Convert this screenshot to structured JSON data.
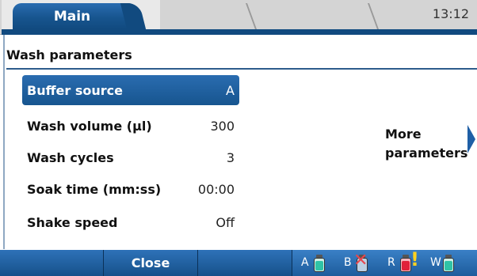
{
  "header": {
    "tab_main": "Main",
    "clock": "13:12"
  },
  "section": {
    "title": "Wash parameters"
  },
  "parameters": [
    {
      "label": "Buffer source",
      "value": "A",
      "selected": true
    },
    {
      "label": "Wash volume (µl)",
      "value": "300",
      "selected": false
    },
    {
      "label": "Wash cycles",
      "value": "3",
      "selected": false
    },
    {
      "label": "Soak time (mm:ss)",
      "value": "00:00",
      "selected": false
    },
    {
      "label": "Shake speed",
      "value": "Off",
      "selected": false
    }
  ],
  "more": {
    "line1": "More",
    "line2": "parameters"
  },
  "footer": {
    "close_label": "Close",
    "bottles": [
      {
        "letter": "A",
        "status": "ok",
        "color": "#2fc3a6"
      },
      {
        "letter": "B",
        "status": "missing",
        "color": "#e8474e"
      },
      {
        "letter": "R",
        "status": "warning",
        "color": "#e0223a"
      },
      {
        "letter": "W",
        "status": "ok",
        "color": "#2fc3a6"
      }
    ]
  },
  "colors": {
    "accent": "#17558f",
    "selected_row": "#1f64a8"
  }
}
